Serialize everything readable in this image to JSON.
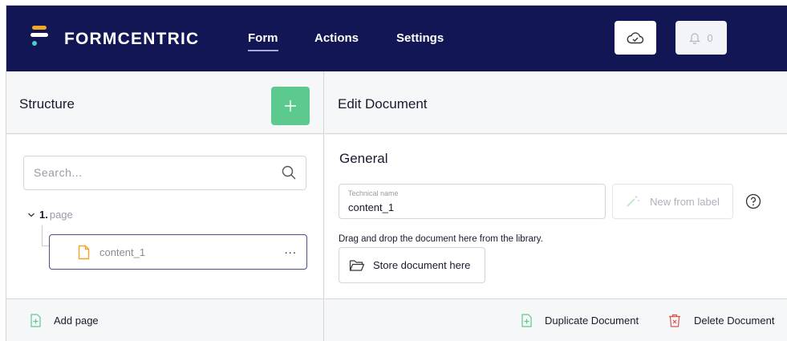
{
  "app": {
    "brand": "FORMCENTRIC",
    "nav": [
      {
        "label": "Form",
        "active": true
      },
      {
        "label": "Actions",
        "active": false
      },
      {
        "label": "Settings",
        "active": false
      }
    ],
    "notifications_count": "0"
  },
  "colors": {
    "nav_bg": "#121655",
    "accent_green": "#5cc98e",
    "delete_red": "#e0504a",
    "file_orange": "#f5a524"
  },
  "structure": {
    "title": "Structure",
    "search_placeholder": "Search...",
    "page_number": "1.",
    "page_label": "page",
    "node_name": "content_1",
    "node_menu": "...",
    "add_page": "Add page"
  },
  "edit": {
    "title": "Edit Document",
    "section": "General",
    "technical_name_label": "Technical name",
    "technical_name_value": "content_1",
    "new_from_label": "New from label",
    "drag_text": "Drag and drop the document here from the library.",
    "store_label": "Store document here",
    "duplicate": "Duplicate Document",
    "delete": "Delete Document"
  },
  "icons": [
    "cloud-check-icon",
    "bell-icon",
    "plus-icon",
    "search-icon",
    "chevron-down-icon",
    "file-icon",
    "more-icon",
    "magic-wand-icon",
    "help-icon",
    "folder-icon",
    "file-plus-icon",
    "trash-icon"
  ]
}
